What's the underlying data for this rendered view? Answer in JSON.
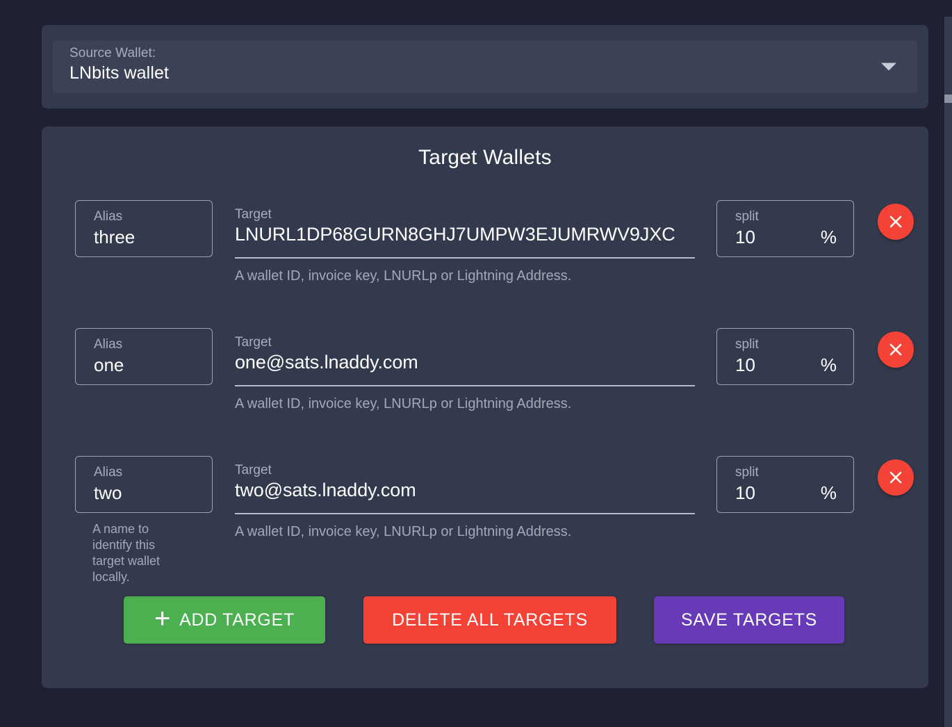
{
  "source": {
    "label": "Source Wallet:",
    "value": "LNbits wallet",
    "arrow_icon": "chevron-down-icon"
  },
  "targets_card": {
    "title": "Target Wallets",
    "rows": [
      {
        "alias_label": "Alias",
        "alias_value": "three",
        "alias_hint": "",
        "target_label": "Target",
        "target_value": "LNURL1DP68GURN8GHJ7UMPW3EJUMRWV9JXC",
        "target_hint": "A wallet ID, invoice key, LNURLp or Lightning Address.",
        "split_label": "split",
        "split_value": "10",
        "split_suffix": "%",
        "delete_icon": "close-icon"
      },
      {
        "alias_label": "Alias",
        "alias_value": "one",
        "alias_hint": "",
        "target_label": "Target",
        "target_value": "one@sats.lnaddy.com",
        "target_hint": "A wallet ID, invoice key, LNURLp or Lightning Address.",
        "split_label": "split",
        "split_value": "10",
        "split_suffix": "%",
        "delete_icon": "close-icon"
      },
      {
        "alias_label": "Alias",
        "alias_value": "two",
        "alias_hint": "A name to identify this target wallet locally.",
        "target_label": "Target",
        "target_value": "two@sats.lnaddy.com",
        "target_hint": "A wallet ID, invoice key, LNURLp or Lightning Address.",
        "split_label": "split",
        "split_value": "10",
        "split_suffix": "%",
        "delete_icon": "close-icon"
      }
    ],
    "actions": {
      "add_label": "ADD TARGET",
      "add_icon": "plus-icon",
      "delete_all_label": "DELETE ALL TARGETS",
      "save_label": "SAVE TARGETS"
    }
  },
  "colors": {
    "page_background": "#1f2031",
    "card_background": "#343a4d",
    "field_background": "#3c4256",
    "add_green": "#4caf50",
    "delete_red": "#f44336",
    "save_purple": "#673ab7",
    "text_primary": "#ffffff",
    "text_muted": "#a9adbb"
  }
}
